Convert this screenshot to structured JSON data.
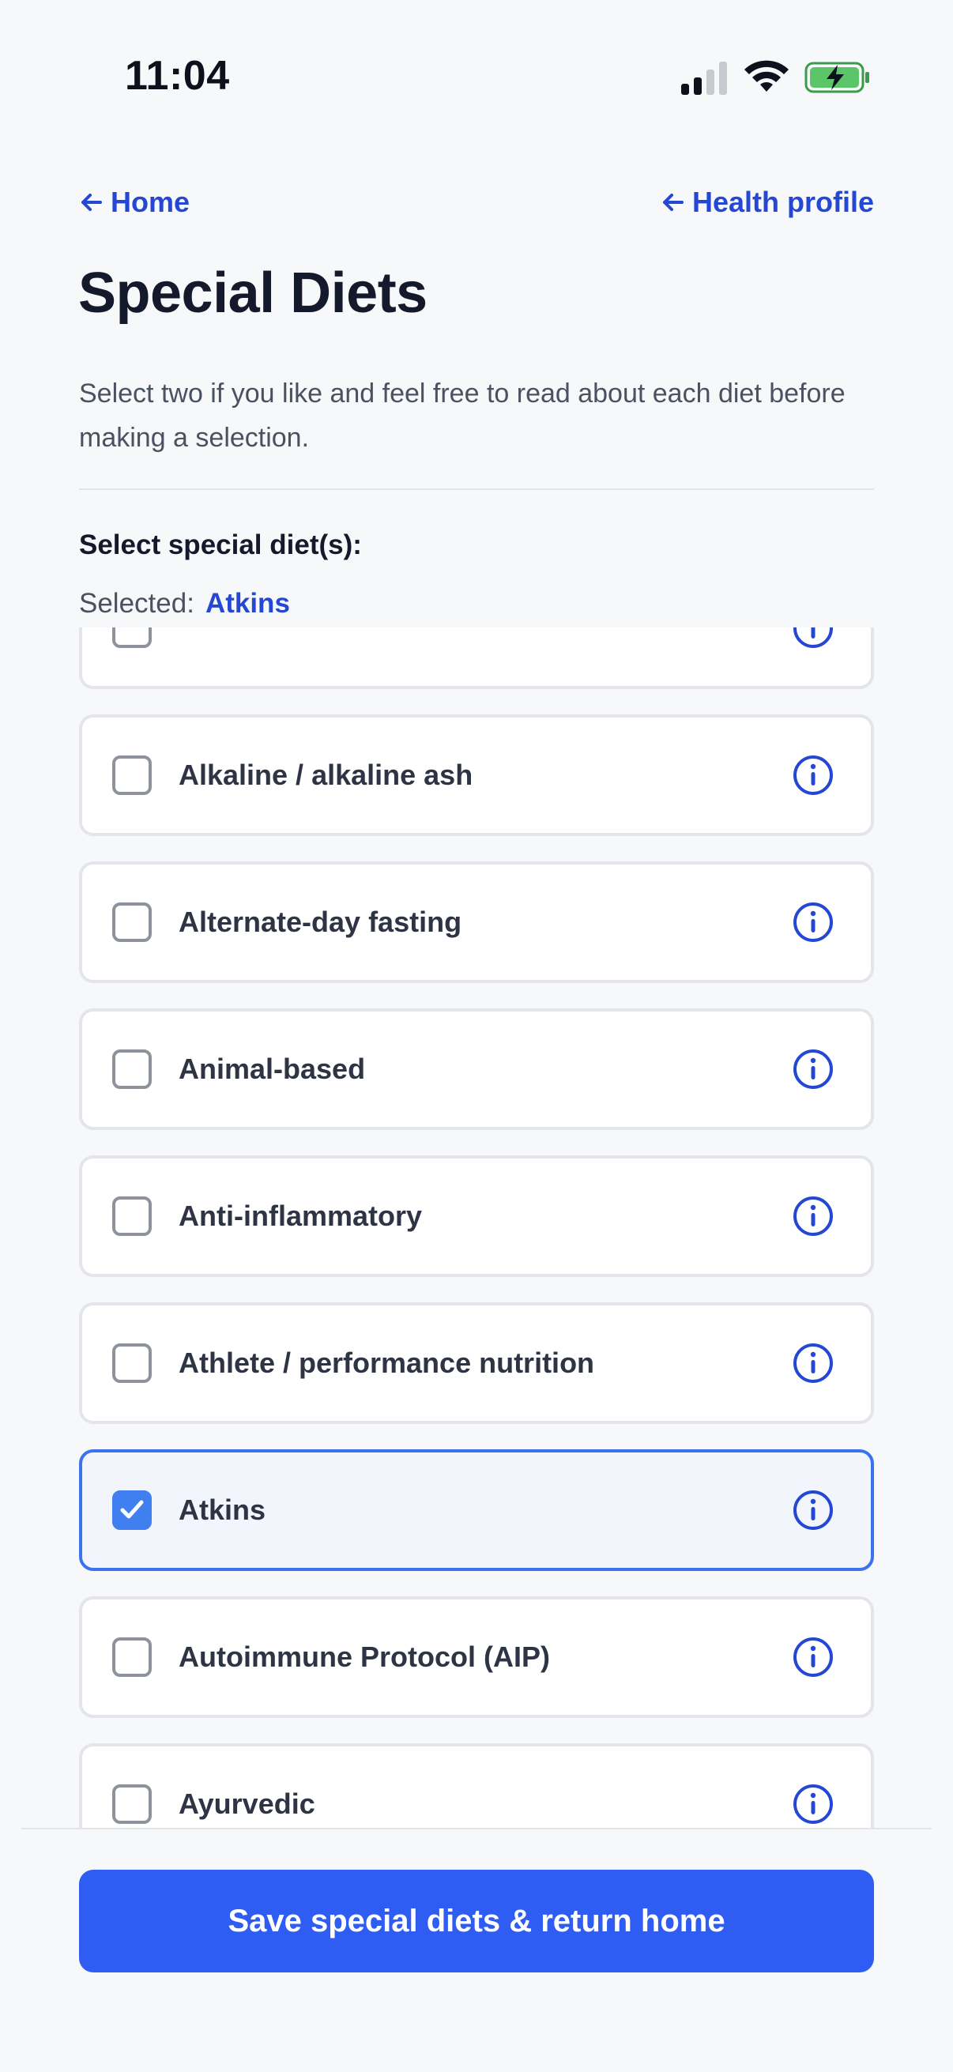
{
  "status_bar": {
    "time": "11:04"
  },
  "nav": {
    "home_label": "Home",
    "health_profile_label": "Health profile"
  },
  "page": {
    "title": "Special Diets",
    "description": "Select two if you like and feel free to read about each diet before making a selection.",
    "select_label": "Select special diet(s):",
    "selected_prefix": "Selected:",
    "selected_value": "Atkins"
  },
  "diets": [
    {
      "label": "",
      "checked": false
    },
    {
      "label": "Alkaline / alkaline ash",
      "checked": false
    },
    {
      "label": "Alternate-day fasting",
      "checked": false
    },
    {
      "label": "Animal-based",
      "checked": false
    },
    {
      "label": "Anti-inflammatory",
      "checked": false
    },
    {
      "label": "Athlete / performance nutrition",
      "checked": false
    },
    {
      "label": "Atkins",
      "checked": true
    },
    {
      "label": "Autoimmune Protocol (AIP)",
      "checked": false
    },
    {
      "label": "Ayurvedic",
      "checked": false
    }
  ],
  "footer": {
    "save_label": "Save special diets & return home"
  },
  "colors": {
    "accent": "#2f5cf2",
    "link": "#2447d4",
    "selected_border": "#3b73ee",
    "checkbox_checked": "#3f7ff0"
  }
}
